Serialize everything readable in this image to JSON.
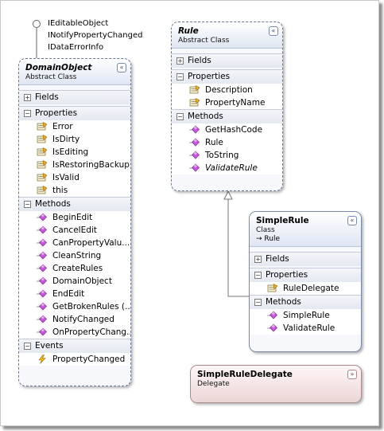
{
  "interfaces": [
    "IEditableObject",
    "INotifyPropertyChanged",
    "IDataErrorInfo"
  ],
  "domain_object": {
    "name": "DomainObject",
    "kind": "Abstract Class",
    "sections": {
      "fields": "Fields",
      "properties": "Properties",
      "methods": "Methods",
      "events": "Events"
    },
    "properties": [
      "Error",
      "IsDirty",
      "IsEditing",
      "IsRestoringBackup",
      "IsValid",
      "this"
    ],
    "methods": [
      "BeginEdit",
      "CancelEdit",
      "CanPropertyValu...",
      "CleanString",
      "CreateRules",
      "DomainObject",
      "EndEdit",
      "GetBrokenRules (...",
      "NotifyChanged",
      "OnPropertyChang..."
    ],
    "events": [
      "PropertyChanged"
    ]
  },
  "rule": {
    "name": "Rule",
    "kind": "Abstract Class",
    "sections": {
      "fields": "Fields",
      "properties": "Properties",
      "methods": "Methods"
    },
    "properties": [
      "Description",
      "PropertyName"
    ],
    "methods": [
      "GetHashCode",
      "Rule",
      "ToString",
      "ValidateRule"
    ]
  },
  "simple_rule": {
    "name": "SimpleRule",
    "kind": "Class",
    "base": "→ Rule",
    "sections": {
      "fields": "Fields",
      "properties": "Properties",
      "methods": "Methods"
    },
    "properties": [
      "RuleDelegate"
    ],
    "methods": [
      "SimpleRule",
      "ValidateRule"
    ]
  },
  "simple_rule_delegate": {
    "name": "SimpleRuleDelegate",
    "kind": "Delegate"
  },
  "glyphs": {
    "expanded": "−",
    "collapsed": "+",
    "collapse": "«",
    "expand": "»"
  },
  "colors": {
    "method": "#b04ac8",
    "property": "#d8a020",
    "event": "#e8b010",
    "border": "#7a8aa8"
  }
}
